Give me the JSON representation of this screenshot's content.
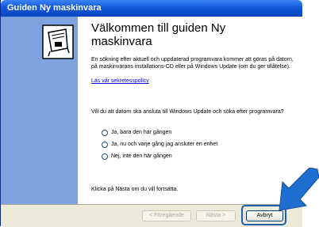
{
  "window": {
    "title": "Guiden Ny maskinvara"
  },
  "heading": "Välkommen till guiden Ny maskinvara",
  "intro": "En sökning efter aktuell och uppdaterad programvara kommer att göras på datorn, på maskinvarans installations-CD eller på Windows Update (om du ger tillåtelse).",
  "privacy_link": "Läs vår sekretesspolicy",
  "question": "Vill du att datorn ska ansluta till Windows Update och söka efter programvara?",
  "options": [
    {
      "label": "Ja, bara den här gången"
    },
    {
      "label": "Ja, nu och varje gång jag ansluter en enhet"
    },
    {
      "label": "Nej, inte den här gången"
    }
  ],
  "footer_text": "Klicka på Nästa om du vill fortsätta.",
  "buttons": {
    "back": "< Föregående",
    "next": "Nästa >",
    "cancel": "Avbryt"
  },
  "colors": {
    "titlebar": "#0d4fcf",
    "left_panel": "#7ea2df",
    "arrow": "#1f6fd1",
    "button_bar": "#ece9d8"
  },
  "icons": {
    "wizard": "hardware-card-icon",
    "arrow": "pointer-arrow-icon"
  }
}
